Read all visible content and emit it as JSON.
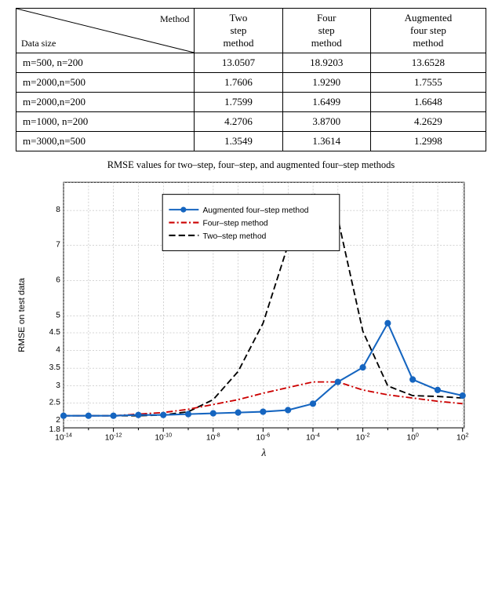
{
  "table": {
    "corner_top": "Method",
    "corner_bottom": "Data size",
    "columns": [
      "Two\nstep\nmethod",
      "Four\nstep\nmethod",
      "Augmented\nfour step\nmethod"
    ],
    "rows": [
      {
        "label": "m=500, n=200",
        "values": [
          "13.0507",
          "18.9203",
          "13.6528"
        ]
      },
      {
        "label": "m=2000,n=500",
        "values": [
          "1.7606",
          "1.9290",
          "1.7555"
        ]
      },
      {
        "label": "m=2000,n=200",
        "values": [
          "1.7599",
          "1.6499",
          "1.6648"
        ]
      },
      {
        "label": "m=1000, n=200",
        "values": [
          "4.2706",
          "3.8700",
          "4.2629"
        ]
      },
      {
        "label": "m=3000,n=500",
        "values": [
          "1.3549",
          "1.3614",
          "1.2998"
        ]
      }
    ]
  },
  "chart": {
    "title": "RMSE values for two–step, four–step, and augmented four–step methods",
    "y_label": "RMSE on test data",
    "x_label": "λ",
    "legend": [
      {
        "label": "Augmented four–step method",
        "color": "#1565C0",
        "style": "solid"
      },
      {
        "label": "Four–step method",
        "color": "#cc0000",
        "style": "dash-dot"
      },
      {
        "label": "Two–step method",
        "color": "#000000",
        "style": "dashed"
      }
    ]
  }
}
